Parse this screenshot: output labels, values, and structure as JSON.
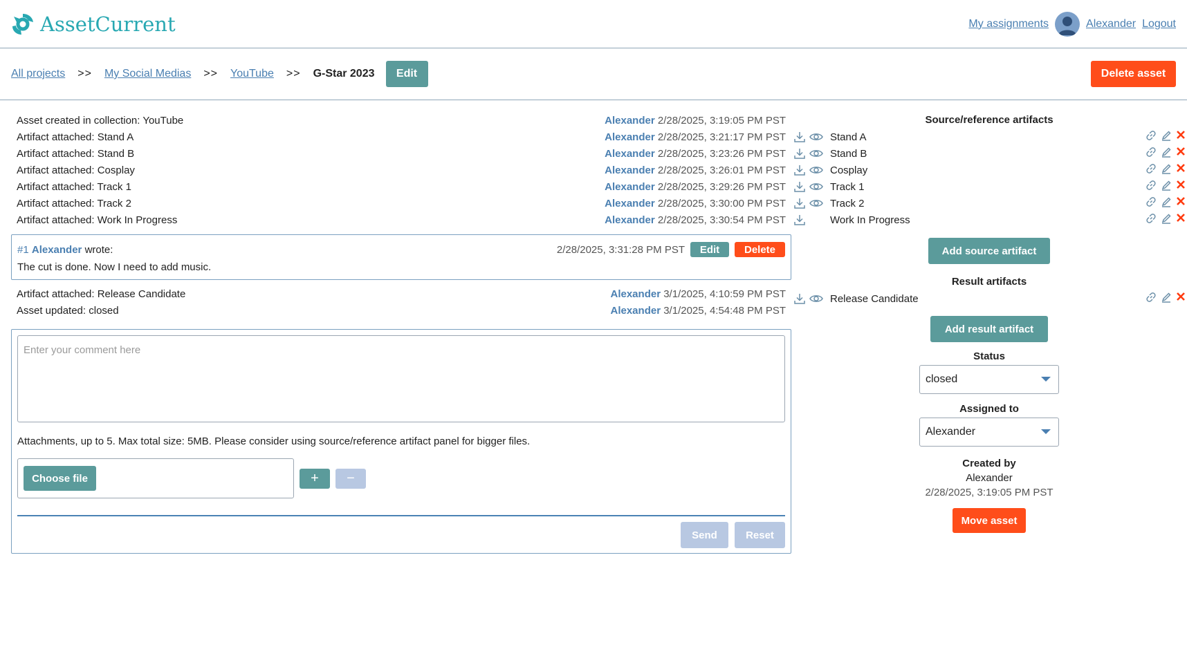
{
  "app": {
    "name": "AssetCurrent",
    "nav": {
      "assignments": "My assignments",
      "user": "Alexander",
      "logout": "Logout"
    }
  },
  "breadcrumb": {
    "items": [
      "All projects",
      "My Social Medias",
      "YouTube"
    ],
    "separator": ">>",
    "current": "G-Star 2023",
    "edit_label": "Edit",
    "delete_label": "Delete asset"
  },
  "history": [
    {
      "text": "Asset created in collection: YouTube",
      "user": "Alexander",
      "time": "2/28/2025, 3:19:05 PM PST"
    },
    {
      "text": "Artifact attached: Stand A",
      "user": "Alexander",
      "time": "2/28/2025, 3:21:17 PM PST"
    },
    {
      "text": "Artifact attached: Stand B",
      "user": "Alexander",
      "time": "2/28/2025, 3:23:26 PM PST"
    },
    {
      "text": "Artifact attached: Cosplay",
      "user": "Alexander",
      "time": "2/28/2025, 3:26:01 PM PST"
    },
    {
      "text": "Artifact attached: Track 1",
      "user": "Alexander",
      "time": "2/28/2025, 3:29:26 PM PST"
    },
    {
      "text": "Artifact attached: Track 2",
      "user": "Alexander",
      "time": "2/28/2025, 3:30:00 PM PST"
    },
    {
      "text": "Artifact attached: Work In Progress",
      "user": "Alexander",
      "time": "2/28/2025, 3:30:54 PM PST"
    }
  ],
  "comment": {
    "number": "#1",
    "user": "Alexander",
    "wrote": "wrote:",
    "time": "2/28/2025, 3:31:28 PM PST",
    "edit_label": "Edit",
    "delete_label": "Delete",
    "body": "The cut is done. Now I need to add music."
  },
  "history2": [
    {
      "text": "Artifact attached: Release Candidate",
      "user": "Alexander",
      "time": "3/1/2025, 4:10:59 PM PST"
    },
    {
      "text": "Asset updated: closed",
      "user": "Alexander",
      "time": "3/1/2025, 4:54:48 PM PST"
    }
  ],
  "composer": {
    "placeholder": "Enter your comment here",
    "hint": "Attachments, up to 5. Max total size: 5MB. Please consider using source/reference artifact panel for bigger files.",
    "choose_file": "Choose file",
    "plus": "+",
    "minus": "−",
    "send": "Send",
    "reset": "Reset"
  },
  "source_panel": {
    "title": "Source/reference artifacts",
    "items": [
      {
        "name": "Stand A",
        "preview": true
      },
      {
        "name": "Stand B",
        "preview": true
      },
      {
        "name": "Cosplay",
        "preview": true
      },
      {
        "name": "Track 1",
        "preview": true
      },
      {
        "name": "Track 2",
        "preview": true
      },
      {
        "name": "Work In Progress",
        "preview": false
      }
    ],
    "add_label": "Add source artifact"
  },
  "result_panel": {
    "title": "Result artifacts",
    "items": [
      {
        "name": "Release Candidate",
        "preview": true
      }
    ],
    "add_label": "Add result artifact"
  },
  "status": {
    "label": "Status",
    "value": "closed"
  },
  "assigned": {
    "label": "Assigned to",
    "value": "Alexander"
  },
  "created": {
    "label": "Created by",
    "user": "Alexander",
    "time": "2/28/2025, 3:19:05 PM PST"
  },
  "move_label": "Move asset",
  "colors": {
    "accent_teal": "#5b9b9b",
    "danger": "#ff4d1a",
    "link": "#4a7fb1",
    "brand": "#28a8b2"
  }
}
